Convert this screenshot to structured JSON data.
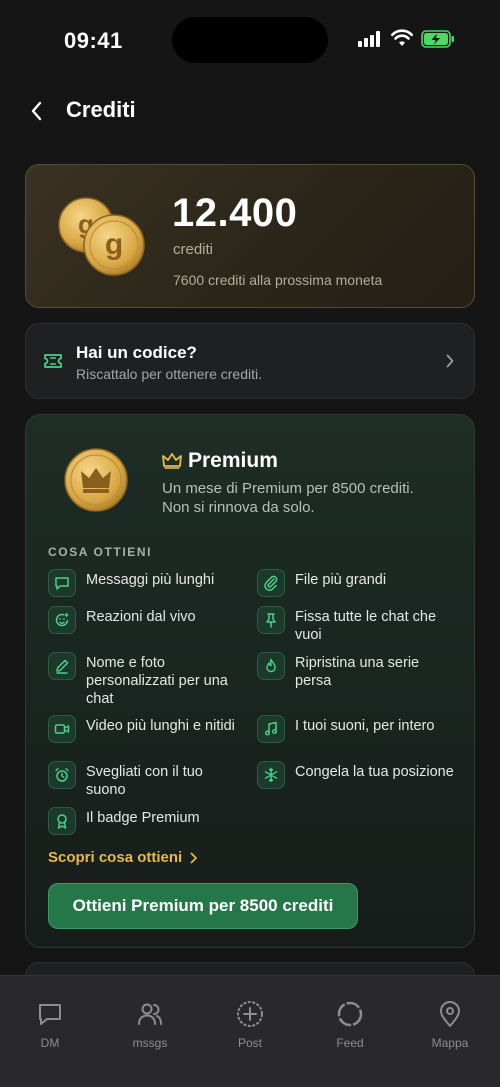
{
  "status": {
    "time": "09:41"
  },
  "header": {
    "title": "Crediti"
  },
  "balance": {
    "amount": "12.400",
    "unit": "crediti",
    "next": "7600 crediti alla prossima moneta"
  },
  "code": {
    "title": "Hai un codice?",
    "subtitle": "Riscattalo per ottenere crediti."
  },
  "premium": {
    "title": "Premium",
    "description": "Un mese di Premium per 8500 crediti. Non si rinnova da solo.",
    "section_label": "COSA OTTIENI",
    "features": [
      {
        "label": "Messaggi più lunghi",
        "icon": "message-icon"
      },
      {
        "label": "File più grandi",
        "icon": "paperclip-icon"
      },
      {
        "label": "Reazioni dal vivo",
        "icon": "smile-plus-icon"
      },
      {
        "label": "Fissa tutte le chat che vuoi",
        "icon": "pin-icon"
      },
      {
        "label": "Nome e foto personalizzati per una chat",
        "icon": "pencil-icon"
      },
      {
        "label": "Ripristina una serie persa",
        "icon": "flame-icon"
      },
      {
        "label": "Video più lunghi e nitidi",
        "icon": "video-icon"
      },
      {
        "label": "I tuoi suoni, per intero",
        "icon": "music-icon"
      },
      {
        "label": "Svegliati con il tuo suono",
        "icon": "alarm-icon"
      },
      {
        "label": "Congela la tua posizione",
        "icon": "snowflake-icon"
      },
      {
        "label": "Il badge Premium",
        "icon": "badge-icon"
      }
    ],
    "discover": "Scopri cosa ottieni",
    "cta": "Ottieni Premium per 8500 crediti"
  },
  "tabs": [
    {
      "label": "DM",
      "icon": "chat-icon"
    },
    {
      "label": "mssgs",
      "icon": "users-icon"
    },
    {
      "label": "Post",
      "icon": "plus-circle-icon"
    },
    {
      "label": "Feed",
      "icon": "ring-icon"
    },
    {
      "label": "Mappa",
      "icon": "map-pin-icon"
    }
  ],
  "colors": {
    "accent_gold": "#e7b94a",
    "accent_green": "#25774a",
    "icon_green": "#4fd08a"
  }
}
